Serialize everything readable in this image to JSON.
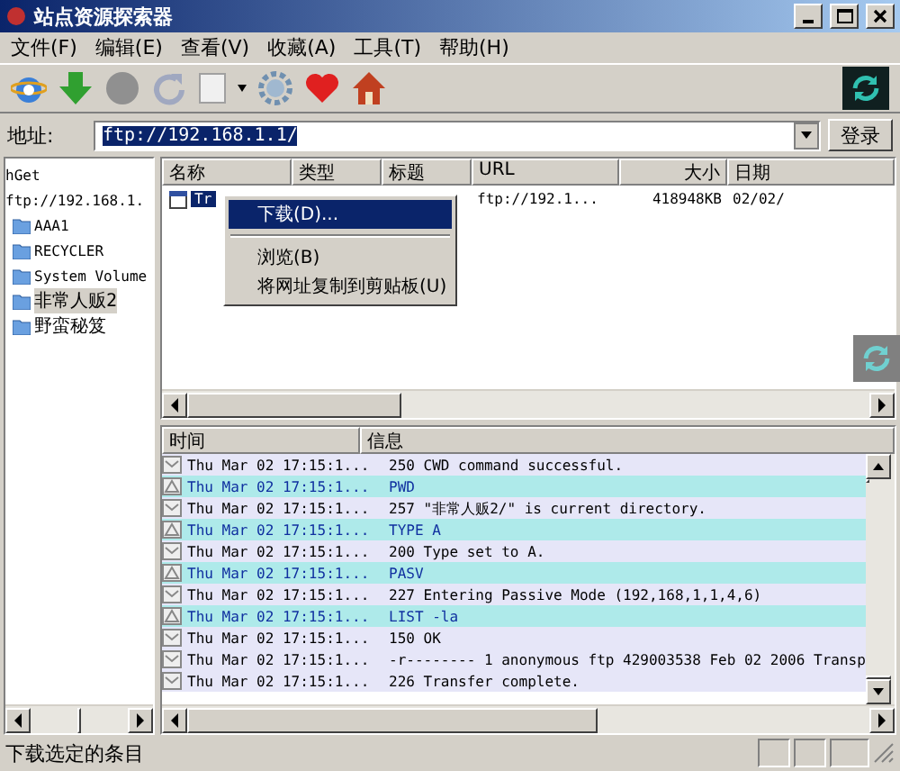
{
  "window": {
    "title": "站点资源探索器"
  },
  "menu": [
    "文件(F)",
    "编辑(E)",
    "查看(V)",
    "收藏(A)",
    "工具(T)",
    "帮助(H)"
  ],
  "address": {
    "label": "地址:",
    "value": "ftp://192.168.1.1/",
    "button": "登录"
  },
  "tree": {
    "root": "hGet",
    "site": "ftp://192.168.1.",
    "children": [
      {
        "label": "AAA1",
        "selected": false
      },
      {
        "label": "RECYCLER",
        "selected": false
      },
      {
        "label": "System Volume",
        "selected": false
      },
      {
        "label": "非常人贩2",
        "selected": true
      },
      {
        "label": "野蛮秘笈",
        "selected": false
      }
    ]
  },
  "files": {
    "columns": [
      "名称",
      "类型",
      "标题",
      "URL",
      "大小",
      "日期"
    ],
    "rows": [
      {
        "name": "Tr",
        "type": "",
        "title": "",
        "url": "ftp://192.1...",
        "size": "418948KB",
        "date": "02/02/",
        "selected": true
      }
    ]
  },
  "context_menu": [
    {
      "label": "下载(D)...",
      "selected": true
    },
    {
      "label": "浏览(B)",
      "selected": false
    },
    {
      "label": "将网址复制到剪贴板(U)",
      "selected": false
    }
  ],
  "log": {
    "columns": [
      "时间",
      "信息"
    ],
    "rows": [
      {
        "kind": "response",
        "time": "Thu Mar 02 17:15:1...",
        "info": "250 CWD command successful."
      },
      {
        "kind": "command",
        "time": "Thu Mar 02 17:15:1...",
        "info": "PWD"
      },
      {
        "kind": "response",
        "time": "Thu Mar 02 17:15:1...",
        "info": "257 \"非常人贩2/\" is current directory."
      },
      {
        "kind": "command",
        "time": "Thu Mar 02 17:15:1...",
        "info": "TYPE A"
      },
      {
        "kind": "response",
        "time": "Thu Mar 02 17:15:1...",
        "info": "200 Type set to A."
      },
      {
        "kind": "command",
        "time": "Thu Mar 02 17:15:1...",
        "info": "PASV"
      },
      {
        "kind": "response",
        "time": "Thu Mar 02 17:15:1...",
        "info": "227 Entering Passive Mode (192,168,1,1,4,6)"
      },
      {
        "kind": "command",
        "time": "Thu Mar 02 17:15:1...",
        "info": "LIST -la"
      },
      {
        "kind": "response",
        "time": "Thu Mar 02 17:15:1...",
        "info": "150 OK"
      },
      {
        "kind": "response",
        "time": "Thu Mar 02 17:15:1...",
        "info": "-r-------- 1 anonymous ftp 429003538 Feb 02 2006 Transp"
      },
      {
        "kind": "response",
        "time": "Thu Mar 02 17:15:1...",
        "info": "226 Transfer complete."
      }
    ]
  },
  "status_bar": {
    "text": "下载选定的条目"
  }
}
